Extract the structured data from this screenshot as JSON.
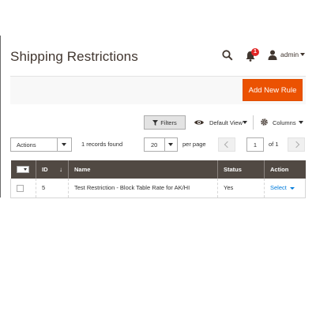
{
  "header": {
    "title": "Shipping Restrictions",
    "notification_count": "1",
    "user_label": "admin"
  },
  "actions": {
    "add_new_label": "Add New Rule"
  },
  "toolbar": {
    "filters_label": "Filters",
    "view_label": "Default View",
    "columns_label": "Columns",
    "mass_actions_label": "Actions",
    "records_found": "1 records found",
    "per_page_value": "20",
    "per_page_label": "per page",
    "current_page": "1",
    "total_pages_label": "of 1"
  },
  "grid": {
    "columns": [
      "ID",
      "Name",
      "Status",
      "Action"
    ],
    "sort_indicator": "↓",
    "rows": [
      {
        "id": "5",
        "name": "Test Restriction - Block Table Rate for AK/HI",
        "status": "Yes",
        "action": "Select"
      }
    ]
  },
  "colors": {
    "accent": "#eb5202",
    "grid_header": "#514943",
    "link": "#007bdb"
  },
  "icons": [
    "search-icon",
    "bell-icon",
    "user-icon",
    "funnel-icon",
    "eye-icon",
    "gear-icon"
  ]
}
